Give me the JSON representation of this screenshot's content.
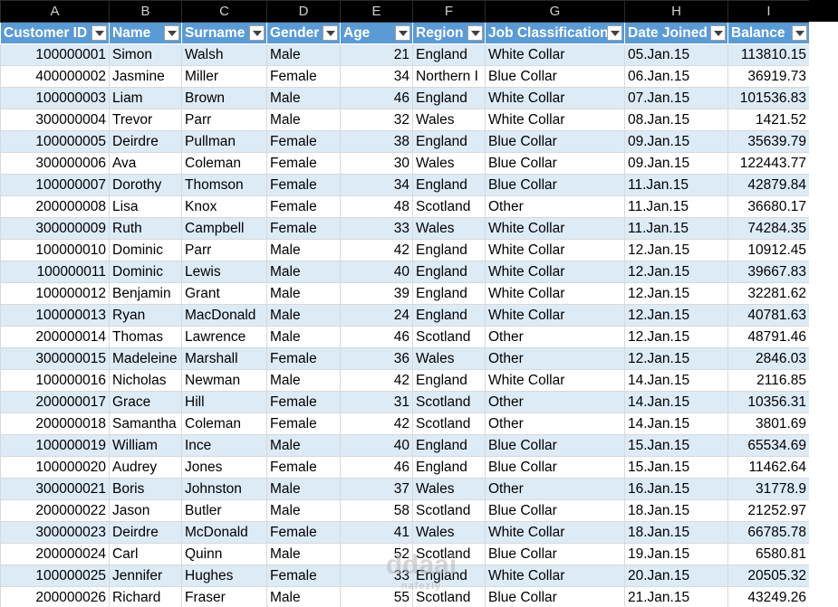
{
  "columns": [
    "A",
    "B",
    "C",
    "D",
    "E",
    "F",
    "G",
    "H",
    "I"
  ],
  "headers": [
    "Customer ID",
    "Name",
    "Surname",
    "Gender",
    "Age",
    "Region",
    "Job Classification",
    "Date Joined",
    "Balance"
  ],
  "rows": [
    [
      "100000001",
      "Simon",
      "Walsh",
      "Male",
      "21",
      "England",
      "White Collar",
      "05.Jan.15",
      "113810.15"
    ],
    [
      "400000002",
      "Jasmine",
      "Miller",
      "Female",
      "34",
      "Northern I",
      "Blue Collar",
      "06.Jan.15",
      "36919.73"
    ],
    [
      "100000003",
      "Liam",
      "Brown",
      "Male",
      "46",
      "England",
      "White Collar",
      "07.Jan.15",
      "101536.83"
    ],
    [
      "300000004",
      "Trevor",
      "Parr",
      "Male",
      "32",
      "Wales",
      "White Collar",
      "08.Jan.15",
      "1421.52"
    ],
    [
      "100000005",
      "Deirdre",
      "Pullman",
      "Female",
      "38",
      "England",
      "Blue Collar",
      "09.Jan.15",
      "35639.79"
    ],
    [
      "300000006",
      "Ava",
      "Coleman",
      "Female",
      "30",
      "Wales",
      "Blue Collar",
      "09.Jan.15",
      "122443.77"
    ],
    [
      "100000007",
      "Dorothy",
      "Thomson",
      "Female",
      "34",
      "England",
      "Blue Collar",
      "11.Jan.15",
      "42879.84"
    ],
    [
      "200000008",
      "Lisa",
      "Knox",
      "Female",
      "48",
      "Scotland",
      "Other",
      "11.Jan.15",
      "36680.17"
    ],
    [
      "300000009",
      "Ruth",
      "Campbell",
      "Female",
      "33",
      "Wales",
      "White Collar",
      "11.Jan.15",
      "74284.35"
    ],
    [
      "100000010",
      "Dominic",
      "Parr",
      "Male",
      "42",
      "England",
      "White Collar",
      "12.Jan.15",
      "10912.45"
    ],
    [
      "100000011",
      "Dominic",
      "Lewis",
      "Male",
      "40",
      "England",
      "White Collar",
      "12.Jan.15",
      "39667.83"
    ],
    [
      "100000012",
      "Benjamin",
      "Grant",
      "Male",
      "39",
      "England",
      "White Collar",
      "12.Jan.15",
      "32281.62"
    ],
    [
      "100000013",
      "Ryan",
      "MacDonald",
      "Male",
      "24",
      "England",
      "White Collar",
      "12.Jan.15",
      "40781.63"
    ],
    [
      "200000014",
      "Thomas",
      "Lawrence",
      "Male",
      "46",
      "Scotland",
      "Other",
      "12.Jan.15",
      "48791.46"
    ],
    [
      "300000015",
      "Madeleine",
      "Marshall",
      "Female",
      "36",
      "Wales",
      "Other",
      "12.Jan.15",
      "2846.03"
    ],
    [
      "100000016",
      "Nicholas",
      "Newman",
      "Male",
      "42",
      "England",
      "White Collar",
      "14.Jan.15",
      "2116.85"
    ],
    [
      "200000017",
      "Grace",
      "Hill",
      "Female",
      "31",
      "Scotland",
      "Other",
      "14.Jan.15",
      "10356.31"
    ],
    [
      "200000018",
      "Samantha",
      "Coleman",
      "Female",
      "42",
      "Scotland",
      "Other",
      "14.Jan.15",
      "3801.69"
    ],
    [
      "100000019",
      "William",
      "Ince",
      "Male",
      "40",
      "England",
      "Blue Collar",
      "15.Jan.15",
      "65534.69"
    ],
    [
      "100000020",
      "Audrey",
      "Jones",
      "Female",
      "46",
      "England",
      "Blue Collar",
      "15.Jan.15",
      "11462.64"
    ],
    [
      "300000021",
      "Boris",
      "Johnston",
      "Male",
      "37",
      "Wales",
      "Other",
      "16.Jan.15",
      "31778.9"
    ],
    [
      "200000022",
      "Jason",
      "Butler",
      "Male",
      "58",
      "Scotland",
      "Blue Collar",
      "18.Jan.15",
      "21252.97"
    ],
    [
      "300000023",
      "Deirdre",
      "McDonald",
      "Female",
      "41",
      "Wales",
      "White Collar",
      "18.Jan.15",
      "66785.78"
    ],
    [
      "200000024",
      "Carl",
      "Quinn",
      "Male",
      "52",
      "Scotland",
      "Blue Collar",
      "19.Jan.15",
      "6580.81"
    ],
    [
      "100000025",
      "Jennifer",
      "Hughes",
      "Female",
      "33",
      "England",
      "White Collar",
      "20.Jan.15",
      "20505.32"
    ],
    [
      "200000026",
      "Richard",
      "Fraser",
      "Male",
      "55",
      "Scotland",
      "Blue Collar",
      "21.Jan.15",
      "43249.26"
    ]
  ],
  "watermark": {
    "main": "ddaai",
    "sub": "nafezly"
  },
  "colors": {
    "header_bg": "#5b9bd5",
    "band_bg": "#ddebf7",
    "colhdr_bg": "#000000"
  }
}
